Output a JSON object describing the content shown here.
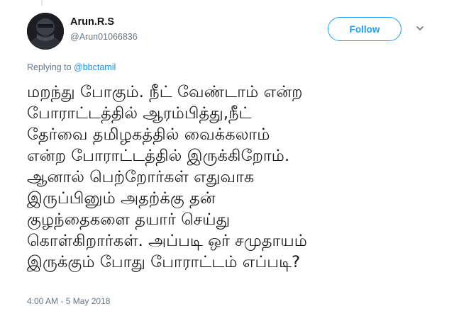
{
  "user": {
    "name": "Arun.R.S",
    "handle": "@Arun01066836"
  },
  "follow_label": "Follow",
  "reply": {
    "prefix": "Replying to ",
    "mention": "@bbctamil"
  },
  "tweet_lines": [
    "மறந்து போகும். நீட் வேண்டாம் என்ற",
    "போராட்டத்தில் ஆரம்பித்து,நீட்",
    "தேர்வை தமிழகத்தில் வைக்கலாம்",
    "என்ற போராட்டத்தில் இருக்கிறோம்.",
    "ஆனால் பெற்றோர்கள் எதுவாக",
    "இருப்பினும் அதற்க்கு தன்",
    "குழந்தைகளை தயார் செய்து",
    "கொள்கிறார்கள். அப்படி ஒர் சமுதாயம்",
    "இருக்கும் போது போராட்டம் எப்படி?"
  ],
  "timestamp": "4:00 AM - 5 May 2018",
  "colors": {
    "accent": "#1da1f2",
    "secondary_text": "#657786",
    "primary_text": "#14171a"
  }
}
